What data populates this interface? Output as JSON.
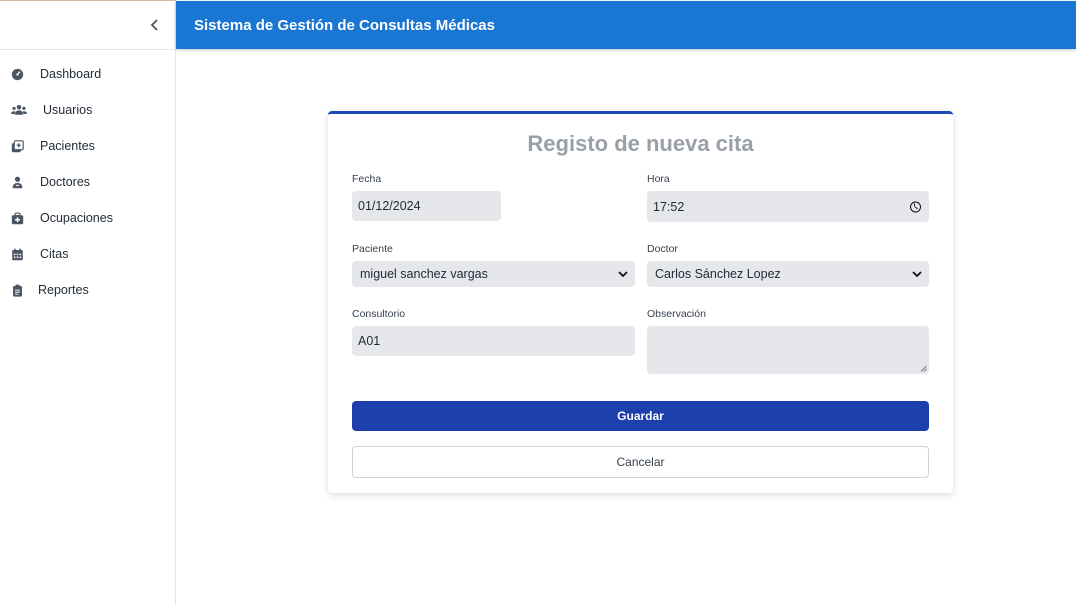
{
  "app": {
    "title": "Sistema de Gestión de Consultas Médicas"
  },
  "sidebar": {
    "items": [
      {
        "label": "Dashboard",
        "icon": "gauge-icon"
      },
      {
        "label": "Usuarios",
        "icon": "users-icon"
      },
      {
        "label": "Pacientes",
        "icon": "hospital-user-icon"
      },
      {
        "label": "Doctores",
        "icon": "doctor-icon"
      },
      {
        "label": "Ocupaciones",
        "icon": "medkit-icon"
      },
      {
        "label": "Citas",
        "icon": "calendar-icon"
      },
      {
        "label": "Reportes",
        "icon": "clipboard-icon"
      }
    ]
  },
  "form": {
    "title": "Registo de nueva cita",
    "fecha": {
      "label": "Fecha",
      "value": "01/12/2024"
    },
    "hora": {
      "label": "Hora",
      "value": "17:52"
    },
    "paciente": {
      "label": "Paciente",
      "value": "miguel sanchez vargas"
    },
    "doctor": {
      "label": "Doctor",
      "value": "Carlos Sánchez Lopez"
    },
    "consultorio": {
      "label": "Consultorio",
      "value": "A01"
    },
    "observacion": {
      "label": "Observación",
      "value": ""
    },
    "save_label": "Guardar",
    "cancel_label": "Cancelar"
  },
  "colors": {
    "header": "#1976d2",
    "primary_button": "#1e40af",
    "card_accent": "#1e4bb8",
    "field_bg": "#e5e7eb"
  }
}
